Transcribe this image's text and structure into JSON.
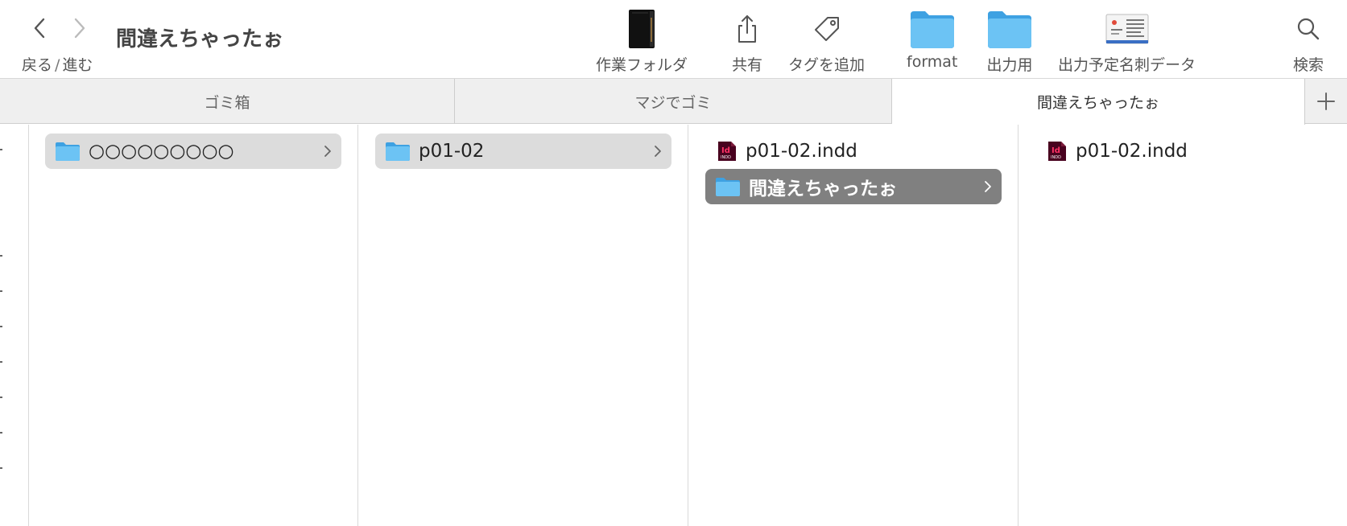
{
  "toolbar": {
    "nav_label_back": "戻る",
    "nav_label_sep": "/",
    "nav_label_forward": "進む",
    "title": "間違えちゃったぉ",
    "items": [
      {
        "label": "作業フォルダ",
        "icon": "book-icon"
      },
      {
        "label": "共有",
        "icon": "share-icon"
      },
      {
        "label": "タグを追加",
        "icon": "tag-icon"
      },
      {
        "label": "format",
        "icon": "folder-icon"
      },
      {
        "label": "出力用",
        "icon": "folder-icon"
      },
      {
        "label": "出力予定名刺データ",
        "icon": "business-card-icon"
      },
      {
        "label": "検索",
        "icon": "search-icon"
      }
    ]
  },
  "tabs": [
    {
      "label": "ゴミ箱",
      "active": false
    },
    {
      "label": "マジでゴミ",
      "active": false
    },
    {
      "label": "間違えちゃったぉ",
      "active": true
    }
  ],
  "columns": [
    {
      "items": [
        {
          "name": "○○○○○○○○○",
          "type": "folder",
          "selected": "grey"
        }
      ]
    },
    {
      "items": [
        {
          "name": "p01-02",
          "type": "folder",
          "selected": "grey"
        }
      ]
    },
    {
      "items": [
        {
          "name": "p01-02.indd",
          "type": "indd",
          "selected": "none"
        },
        {
          "name": "間違えちゃったぉ",
          "type": "folder",
          "selected": "dark"
        }
      ]
    },
    {
      "items": [
        {
          "name": "p01-02.indd",
          "type": "indd",
          "selected": "none"
        }
      ]
    }
  ],
  "colors": {
    "folder": "#5fb8f0",
    "folder_dark": "#3ea1e2",
    "indd": "#49021f",
    "indd_text": "#ff3366",
    "selection_grey": "#dcdcdc",
    "selection_dark": "#808080"
  }
}
